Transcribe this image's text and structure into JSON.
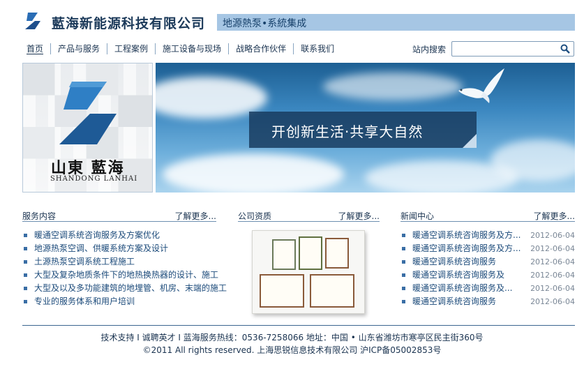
{
  "header": {
    "company_name": "藍海新能源科技有限公司",
    "slogan": "地源熱泵•系統集成"
  },
  "nav": {
    "items": [
      {
        "label": "首页"
      },
      {
        "label": "产品与服务"
      },
      {
        "label": "工程案例"
      },
      {
        "label": "施工设备与现场"
      },
      {
        "label": "战略合作伙伴"
      },
      {
        "label": "联系我们"
      }
    ]
  },
  "search": {
    "label": "站内搜索",
    "value": "",
    "placeholder": ""
  },
  "logo_panel": {
    "name_cn": "山東 藍海",
    "name_en": "SHANDONG LANHAI"
  },
  "banner": {
    "caption": "开创新生活·共享大自然"
  },
  "services": {
    "title": "服务内容",
    "more": "了解更多...",
    "items": [
      "暖通空调系统咨询服务及方案优化",
      "地源热泵空调、供暖系统方案及设计",
      "土源热泵空调系统工程施工",
      "大型及复杂地质条件下的地热换热器的设计、施工",
      "大型及以及多功能建筑的地埋管、机房、末端的施工",
      "专业的服务体系和用户培训"
    ]
  },
  "qualifications": {
    "title": "公司资质",
    "more": "了解更多..."
  },
  "news": {
    "title": "新闻中心",
    "more": "了解更多...",
    "items": [
      {
        "title": "暖通空调系统咨询服务及方...",
        "date": "2012-06-04"
      },
      {
        "title": "暖通空调系统咨询服务及方...",
        "date": "2012-06-04"
      },
      {
        "title": "暖通空调系统咨询服务",
        "date": "2012-06-04"
      },
      {
        "title": "暖通空调系统咨询服务及",
        "date": "2012-06-04"
      },
      {
        "title": "暖通空调系统咨询服务及...",
        "date": "2012-06-04"
      },
      {
        "title": "暖通空调系统咨询服务",
        "date": "2012-06-04"
      }
    ]
  },
  "footer": {
    "line1": "技术支持 I 诚聘英才 I 蓝海服务热线：0536-7258066  地址：中国 • 山东省潍坊市寒亭区民主街360号",
    "line2": "©2011 All rights reserved. 上海思锐信息技术有限公司 沪ICP备05002853号"
  },
  "colors": {
    "brand_blue": "#2563a8",
    "slogan_bar": "#a6c6e4",
    "text_dark": "#1a3350",
    "link_blue": "#1b4a7a"
  }
}
